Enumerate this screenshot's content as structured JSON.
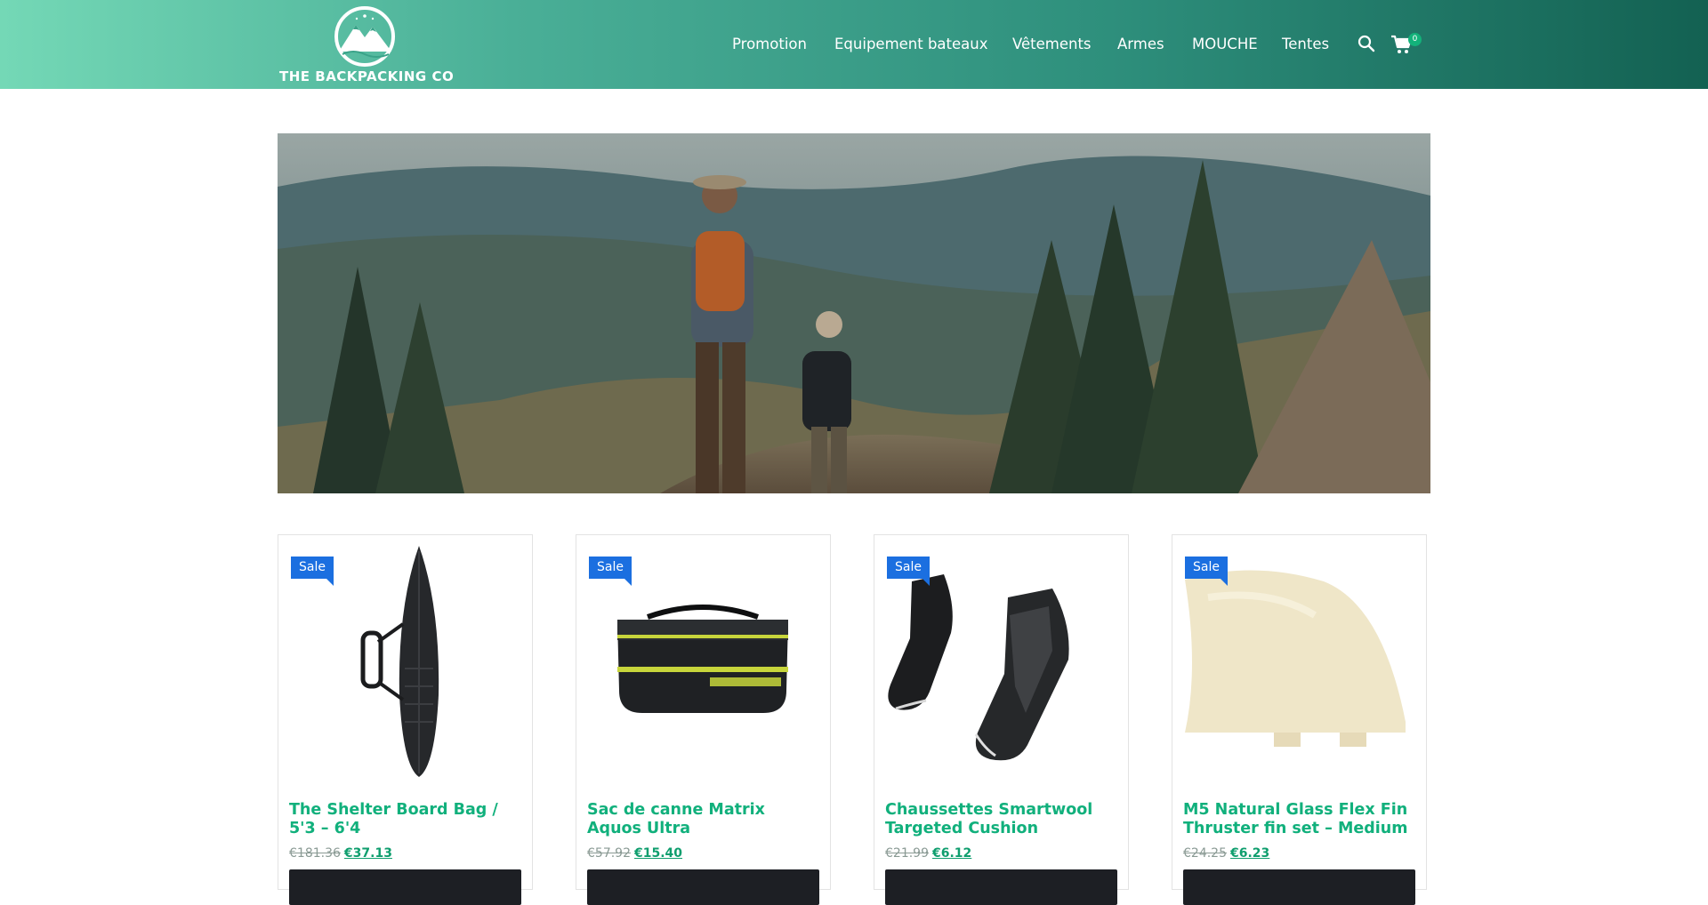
{
  "brand": {
    "name": "THE BACKPACKING CO",
    "logo_icon": "mountain-logo-icon"
  },
  "nav": {
    "items": [
      {
        "label": "Promotion"
      },
      {
        "label": "Equipement bateaux"
      },
      {
        "label": "Vêtements"
      },
      {
        "label": "Armes"
      },
      {
        "label": "MOUCHE"
      },
      {
        "label": "Tentes"
      }
    ],
    "search_icon": "search-icon",
    "cart_icon": "cart-icon",
    "cart_count": "0"
  },
  "hero": {
    "image": "hikers-trail-photo"
  },
  "colors": {
    "accent": "#11b07c",
    "sale_badge": "#1b6fe0",
    "button": "#1d1f24"
  },
  "products": [
    {
      "badge": "Sale",
      "title": "The Shelter Board Bag / 5'3 – 6'4",
      "old_price": "€181.36",
      "price": "€37.13",
      "image": "surfboard-bag-photo"
    },
    {
      "badge": "Sale",
      "title": "Sac de canne Matrix Aquos Ultra",
      "old_price": "€57.92",
      "price": "€15.40",
      "image": "bait-storage-tray-photo"
    },
    {
      "badge": "Sale",
      "title": "Chaussettes Smartwool Targeted Cushion",
      "old_price": "€21.99",
      "price": "€6.12",
      "image": "socks-photo"
    },
    {
      "badge": "Sale",
      "title": "M5 Natural Glass Flex Fin Thruster fin set – Medium",
      "old_price": "€24.25",
      "price": "€6.23",
      "image": "surf-fin-photo"
    }
  ]
}
